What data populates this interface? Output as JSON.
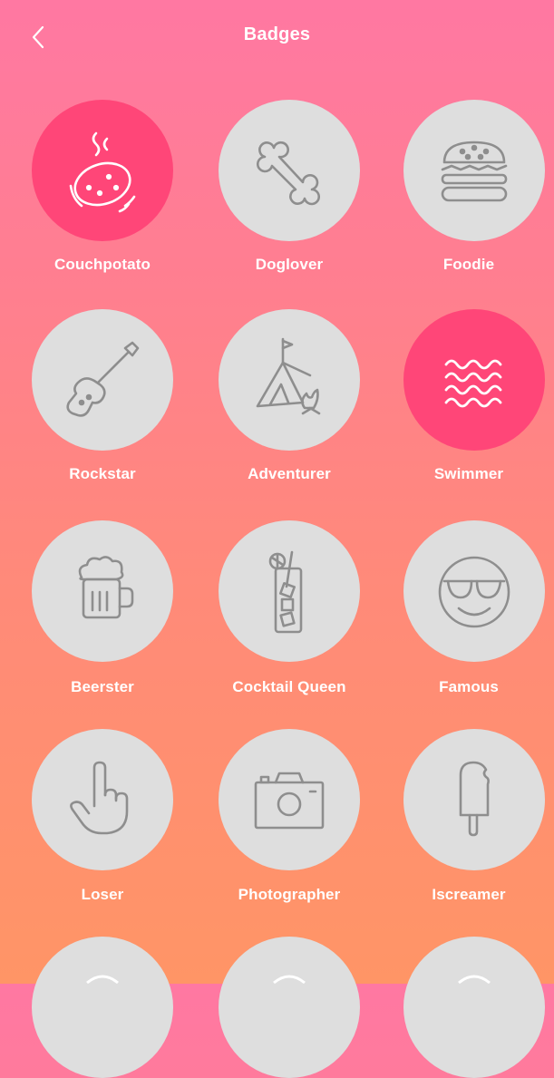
{
  "header": {
    "title": "Badges",
    "back_icon": "chevron-left-icon"
  },
  "colors": {
    "active": "#ff4678",
    "inactive": "#dedede",
    "icon_inactive": "#8e8e8e",
    "icon_active": "#ffffff"
  },
  "badges": [
    {
      "label": "Couchpotato",
      "icon": "potato-icon",
      "active": true
    },
    {
      "label": "Doglover",
      "icon": "bone-icon",
      "active": false
    },
    {
      "label": "Foodie",
      "icon": "burger-icon",
      "active": false
    },
    {
      "label": "Rockstar",
      "icon": "guitar-icon",
      "active": false
    },
    {
      "label": "Adventurer",
      "icon": "tent-icon",
      "active": false
    },
    {
      "label": "Swimmer",
      "icon": "waves-icon",
      "active": true
    },
    {
      "label": "Beerster",
      "icon": "beer-mug-icon",
      "active": false
    },
    {
      "label": "Cocktail Queen",
      "icon": "cocktail-icon",
      "active": false
    },
    {
      "label": "Famous",
      "icon": "sunglasses-face-icon",
      "active": false
    },
    {
      "label": "Loser",
      "icon": "pointing-hand-icon",
      "active": false
    },
    {
      "label": "Photographer",
      "icon": "camera-icon",
      "active": false
    },
    {
      "label": "Iscreamer",
      "icon": "popsicle-icon",
      "active": false
    },
    {
      "label": "",
      "icon": "",
      "active": false
    },
    {
      "label": "",
      "icon": "",
      "active": false
    },
    {
      "label": "",
      "icon": "",
      "active": false
    }
  ]
}
